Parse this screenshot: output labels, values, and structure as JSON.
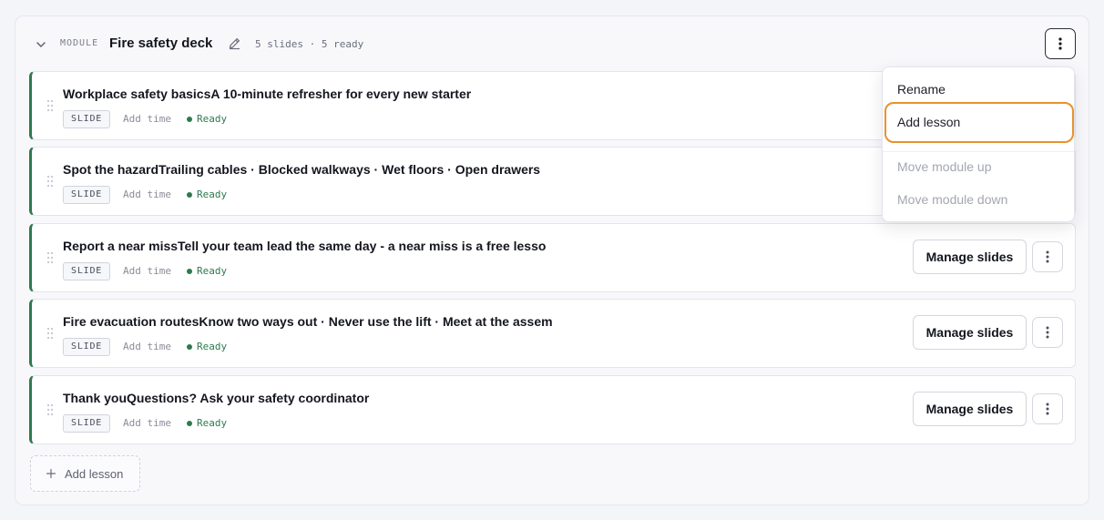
{
  "module": {
    "tag": "MODULE",
    "title": "Fire safety deck",
    "meta": "5 slides · 5 ready"
  },
  "lessons": [
    {
      "title": "Workplace safety basicsA 10-minute refresher for every new starter",
      "tag": "SLIDE",
      "time_label": "Add time",
      "status": "Ready"
    },
    {
      "title": "Spot the hazardTrailing cables · Blocked walkways · Wet floors · Open drawers",
      "tag": "SLIDE",
      "time_label": "Add time",
      "status": "Ready"
    },
    {
      "title": "Report a near missTell your team lead the same day - a near miss is a free lesso",
      "tag": "SLIDE",
      "time_label": "Add time",
      "status": "Ready",
      "manage_label": "Manage slides"
    },
    {
      "title": "Fire evacuation routesKnow two ways out · Never use the lift · Meet at the assem",
      "tag": "SLIDE",
      "time_label": "Add time",
      "status": "Ready",
      "manage_label": "Manage slides"
    },
    {
      "title": "Thank youQuestions? Ask your safety coordinator",
      "tag": "SLIDE",
      "time_label": "Add time",
      "status": "Ready",
      "manage_label": "Manage slides"
    }
  ],
  "add_lesson_label": "Add lesson",
  "menu": {
    "items": [
      "Rename",
      "Add lesson",
      "Move module up",
      "Move module down"
    ],
    "focused": "Add lesson",
    "disabled": [
      "Move module up",
      "Move module down"
    ]
  },
  "colors": {
    "ready": "#2e7a4f",
    "focus_ring": "#e8922e",
    "accent_border": "#2e7a4f"
  }
}
